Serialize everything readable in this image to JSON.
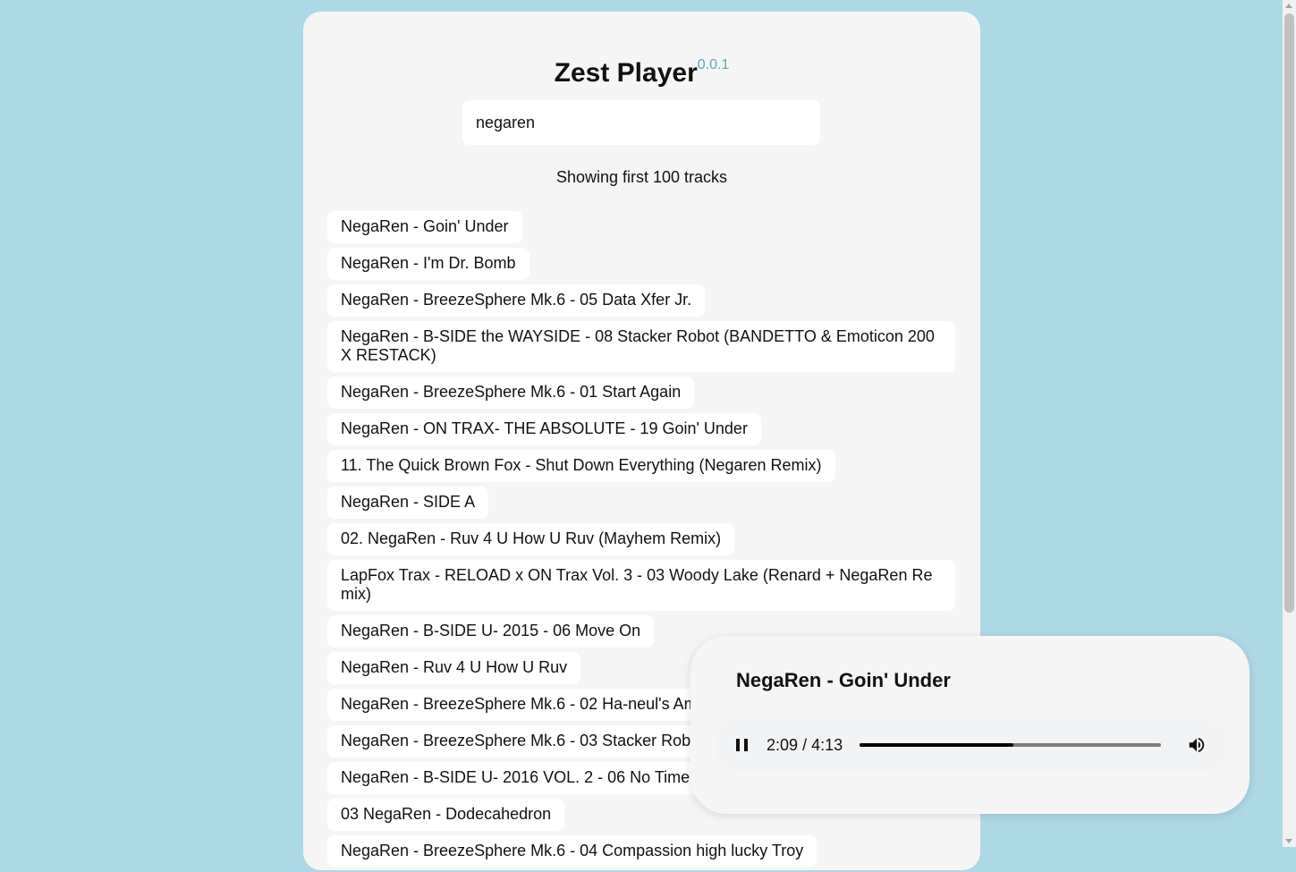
{
  "app": {
    "title": "Zest Player",
    "version": "0.0.1"
  },
  "search": {
    "value": "negaren"
  },
  "results": {
    "summary": "Showing first 100 tracks",
    "tracks": [
      "NegaRen - Goin' Under",
      "NegaRen - I'm Dr. Bomb",
      "NegaRen - BreezeSphere Mk.6 - 05 Data Xfer Jr.",
      "NegaRen - B-SIDE the WAYSIDE - 08 Stacker Robot (BANDETTO & Emoticon 200X RESTACK)",
      "NegaRen - BreezeSphere Mk.6 - 01 Start Again",
      "NegaRen - ON TRAX- THE ABSOLUTE - 19 Goin' Under",
      "11. The Quick Brown Fox - Shut Down Everything (Negaren Remix)",
      "NegaRen - SIDE A",
      "02. NegaRen - Ruv 4 U How U Ruv (Mayhem Remix)",
      "LapFox Trax - RELOAD x ON Trax Vol. 3 - 03 Woody Lake (Renard + NegaRen Remix)",
      "NegaRen - B-SIDE U- 2015 - 06 Move On",
      "NegaRen - Ruv 4 U How U Ruv",
      "NegaRen - BreezeSphere Mk.6 - 02 Ha-neul's Amb",
      "NegaRen - BreezeSphere Mk.6 - 03 Stacker Robot",
      "NegaRen - B-SIDE U- 2016 VOL. 2 - 06 No Time T",
      "03 NegaRen - Dodecahedron",
      "NegaRen - BreezeSphere Mk.6 - 04 Compassion high lucky Troy"
    ]
  },
  "player": {
    "now_playing": "NegaRen - Goin' Under",
    "current_time": "2:09",
    "separator": "/",
    "duration": "4:13",
    "progress_fraction": 0.51,
    "pause_icon": "pause-icon",
    "volume_icon": "volume-icon"
  }
}
